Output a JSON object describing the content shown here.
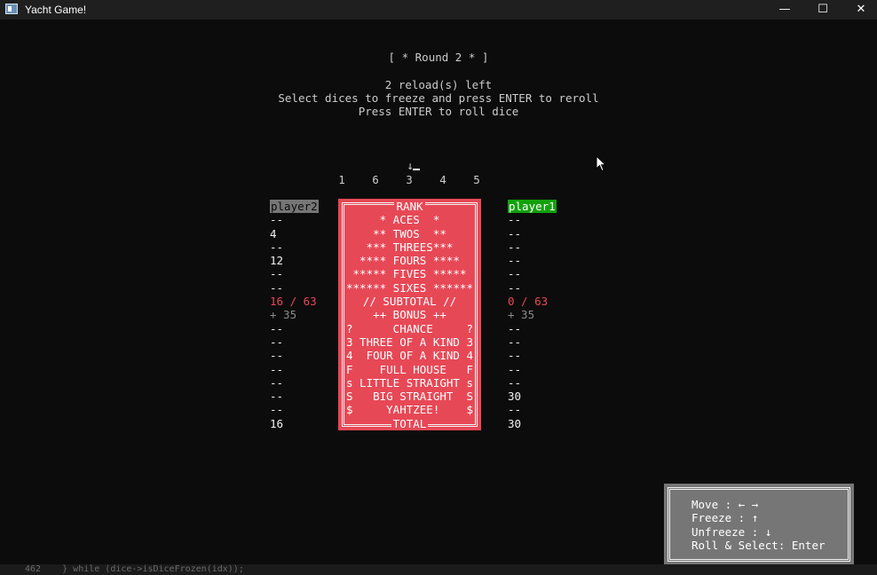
{
  "window": {
    "title": "Yacht Game!",
    "icon": "console-app-icon",
    "controls": [
      "—",
      "☐",
      "✕"
    ]
  },
  "header": {
    "round": "[ * Round 2 * ]",
    "reloads": "2 reload(s) left",
    "instruction1": "Select dices to freeze and press ENTER to reroll",
    "instruction2": "Press ENTER to roll dice"
  },
  "dice": {
    "cursor": "↓",
    "values": [
      "1",
      "6",
      "3",
      "4",
      "5"
    ]
  },
  "scoreboard": {
    "player2": {
      "name": "player2",
      "scores": [
        "--",
        "4",
        "--",
        "12",
        "--",
        "--"
      ],
      "subtotal": "16 / 63",
      "bonus": "+ 35",
      "lower": [
        "--",
        "--",
        "--",
        "--",
        "--",
        "--",
        "--"
      ],
      "total": "16"
    },
    "ranks": {
      "header": "RANK",
      "upper": [
        "* ACES  *",
        "** TWOS  **",
        "*** THREES***",
        "**** FOURS ****",
        "***** FIVES *****",
        "****** SIXES ******"
      ],
      "subtotal": "// SUBTOTAL //",
      "bonus": "++ BONUS ++",
      "lower": [
        "?      CHANCE     ?",
        "3 THREE OF A KIND 3",
        "4  FOUR OF A KIND 4",
        "F    FULL HOUSE   F",
        "s LITTLE STRAIGHT s",
        "S   BIG STRAIGHT  S",
        "$     YAHTZEE!    $"
      ],
      "total": "TOTAL"
    },
    "player1": {
      "name": "player1",
      "scores": [
        "--",
        "--",
        "--",
        "--",
        "--",
        "--"
      ],
      "subtotal": "0 / 63",
      "bonus": "+ 35",
      "lower": [
        "--",
        "--",
        "--",
        "--",
        "--",
        "30",
        "--"
      ],
      "total": "30"
    }
  },
  "help": {
    "move": "Move : ← →",
    "freeze": "Freeze : ↑",
    "unfreeze": "Unfreeze : ↓",
    "roll": "Roll & Select: Enter"
  },
  "editor_strip": "462    } while (dice->isDiceFrozen(idx));",
  "colors": {
    "rank_bg": "#e74856",
    "player1_bg": "#13a10e",
    "player2_bg": "#767676",
    "help_bg": "#767676"
  }
}
